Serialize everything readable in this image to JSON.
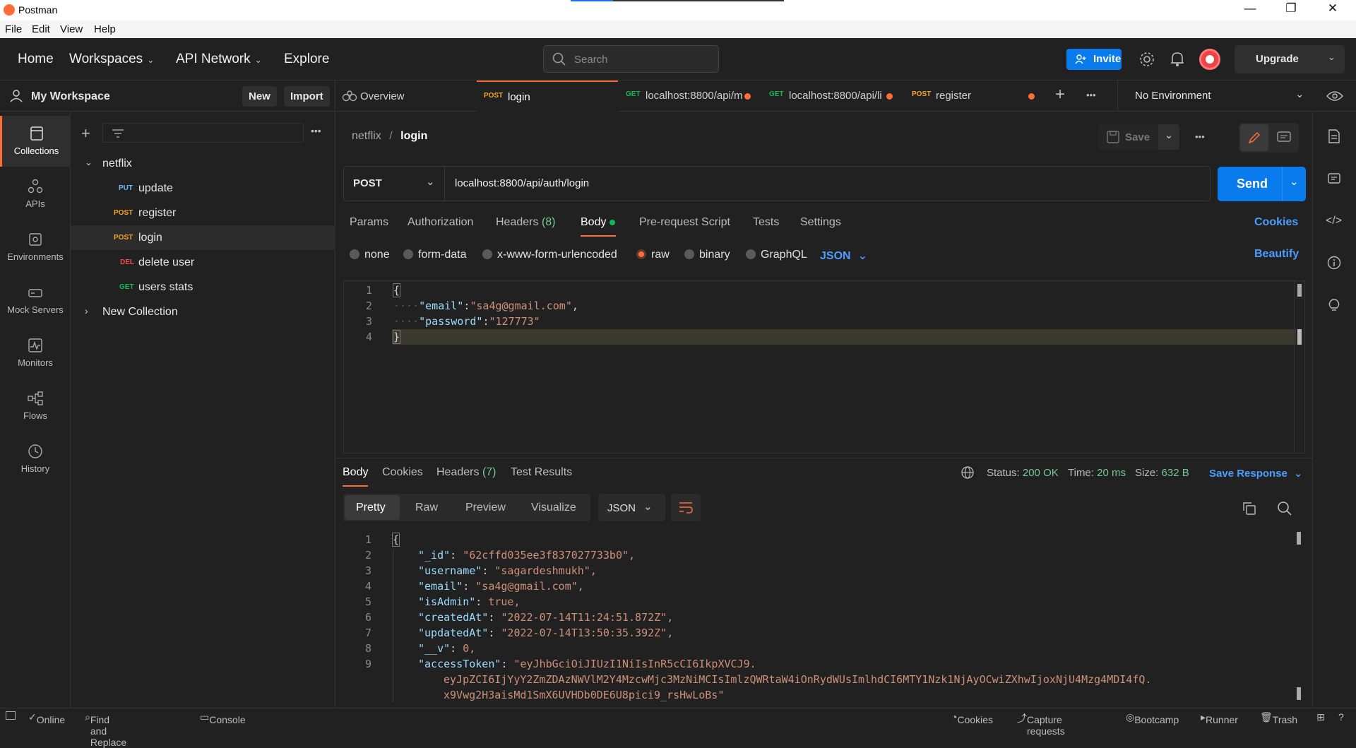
{
  "window": {
    "title": "Postman",
    "minimize": "—",
    "maximize": "❐",
    "close": "✕"
  },
  "menu": [
    "File",
    "Edit",
    "View",
    "Help"
  ],
  "header": {
    "nav": [
      "Home",
      "Workspaces",
      "API Network",
      "Explore"
    ],
    "search_placeholder": "Search",
    "invite_label": "Invite",
    "upgrade_label": "Upgrade"
  },
  "workspace": {
    "name": "My Workspace",
    "new_label": "New",
    "import_label": "Import"
  },
  "rail": [
    "Collections",
    "APIs",
    "Environments",
    "Mock Servers",
    "Monitors",
    "Flows",
    "History"
  ],
  "tree": {
    "collection": "netflix",
    "requests": [
      {
        "method": "PUT",
        "name": "update"
      },
      {
        "method": "POST",
        "name": "register"
      },
      {
        "method": "POST",
        "name": "login"
      },
      {
        "method": "DEL",
        "name": "delete user"
      },
      {
        "method": "GET",
        "name": "users stats"
      }
    ],
    "other_collection": "New Collection"
  },
  "tabs": [
    {
      "method": "",
      "label": "Overview"
    },
    {
      "method": "POST",
      "label": "login"
    },
    {
      "method": "GET",
      "label": "localhost:8800/api/m"
    },
    {
      "method": "GET",
      "label": "localhost:8800/api/li"
    },
    {
      "method": "POST",
      "label": "register"
    }
  ],
  "environment": "No Environment",
  "breadcrumb": {
    "parent": "netflix",
    "sep": "/",
    "current": "login"
  },
  "save_label": "Save",
  "request": {
    "method": "POST",
    "url": "localhost:8800/api/auth/login",
    "send_label": "Send"
  },
  "req_tabs": {
    "params": "Params",
    "authorization": "Authorization",
    "headers": "Headers",
    "headers_count": "(8)",
    "body": "Body",
    "prerequest": "Pre-request Script",
    "tests": "Tests",
    "settings": "Settings",
    "cookies": "Cookies"
  },
  "body_modes": {
    "none": "none",
    "form_data": "form-data",
    "urlencoded": "x-www-form-urlencoded",
    "raw": "raw",
    "binary": "binary",
    "graphql": "GraphQL",
    "lang": "JSON",
    "beautify": "Beautify"
  },
  "request_body": {
    "line_numbers": [
      "1",
      "2",
      "3",
      "4"
    ],
    "open": "{",
    "close": "}",
    "email_key": "\"email\"",
    "email_val": "\"sa4g@gmail.com\"",
    "password_key": "\"password\"",
    "password_val": "\"127773\""
  },
  "response": {
    "tabs": {
      "body": "Body",
      "cookies": "Cookies",
      "headers": "Headers",
      "headers_count": "(7)",
      "test_results": "Test Results"
    },
    "status_label": "Status:",
    "status": "200 OK",
    "time_label": "Time:",
    "time": "20 ms",
    "size_label": "Size:",
    "size": "632 B",
    "save_response": "Save Response",
    "view_modes": [
      "Pretty",
      "Raw",
      "Preview",
      "Visualize"
    ],
    "format": "JSON",
    "line_numbers": [
      "1",
      "2",
      "3",
      "4",
      "5",
      "6",
      "7",
      "8",
      "9"
    ],
    "open": "{",
    "fields": [
      {
        "k": "\"_id\"",
        "v": "\"62cffd035ee3f837027733b0\","
      },
      {
        "k": "\"username\"",
        "v": "\"sagardeshmukh\","
      },
      {
        "k": "\"email\"",
        "v": "\"sa4g@gmail.com\","
      },
      {
        "k": "\"isAdmin\"",
        "v": "true,"
      },
      {
        "k": "\"createdAt\"",
        "v": "\"2022-07-14T11:24:51.872Z\","
      },
      {
        "k": "\"updatedAt\"",
        "v": "\"2022-07-14T13:50:35.392Z\","
      },
      {
        "k": "\"__v\"",
        "v": "0,"
      },
      {
        "k": "\"accessToken\"",
        "v": "\"eyJhbGciOiJIUzI1NiIsInR5cCI6IkpXVCJ9."
      }
    ],
    "token_cont1": "eyJpZCI6IjYyY2ZmZDAzNWVlM2Y4MzcwMjc3MzNiMCIsImlzQWRtaW4iOnRydWUsImlhdCI6MTY1Nzk1NjAyOCwiZXhwIjoxNjU4Mzg4MDI4fQ.",
    "token_cont2": "x9Vwg2H3aisMd1SmX6UVHDb0DE6U8pici9_rsHwLoBs\""
  },
  "statusbar": {
    "online": "Online",
    "find": "Find and Replace",
    "console": "Console",
    "cookies": "Cookies",
    "capture": "Capture requests",
    "bootcamp": "Bootcamp",
    "runner": "Runner",
    "trash": "Trash"
  },
  "colors": {
    "accent": "#ff6c37",
    "primary": "#097bed",
    "ok": "#0cbb52"
  }
}
